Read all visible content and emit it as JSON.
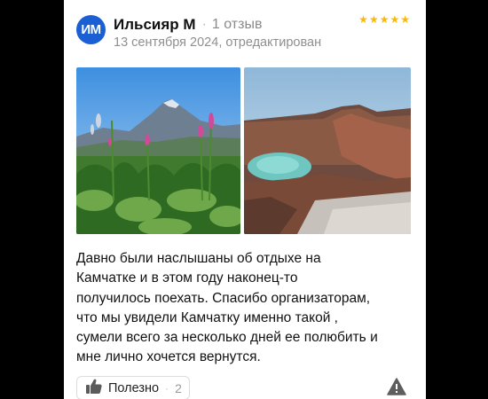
{
  "review": {
    "avatar_initials": "ИМ",
    "author": "Ильсияр М",
    "reviews_count": "1 отзыв",
    "date": "13 сентября 2024, отредактирован",
    "rating": 5,
    "text_lines": [
      "Давно были наслышаны об отдыхе на",
      "Камчатке и в этом году наконец-то",
      "получилось поехать. Спасибо организаторам,",
      "что мы увидели Камчатку именно такой ,",
      "сумели всего за несколько дней ее полюбить и",
      "мне лично хочется вернутся."
    ],
    "photos": [
      {
        "icon": "photo-volcano-fireweed"
      },
      {
        "icon": "photo-crater-lake"
      }
    ],
    "useful": {
      "label": "Полезно",
      "separator": "·",
      "count": "2"
    },
    "colors": {
      "avatar": "#1a5fd4",
      "star": "#fcb900"
    }
  }
}
